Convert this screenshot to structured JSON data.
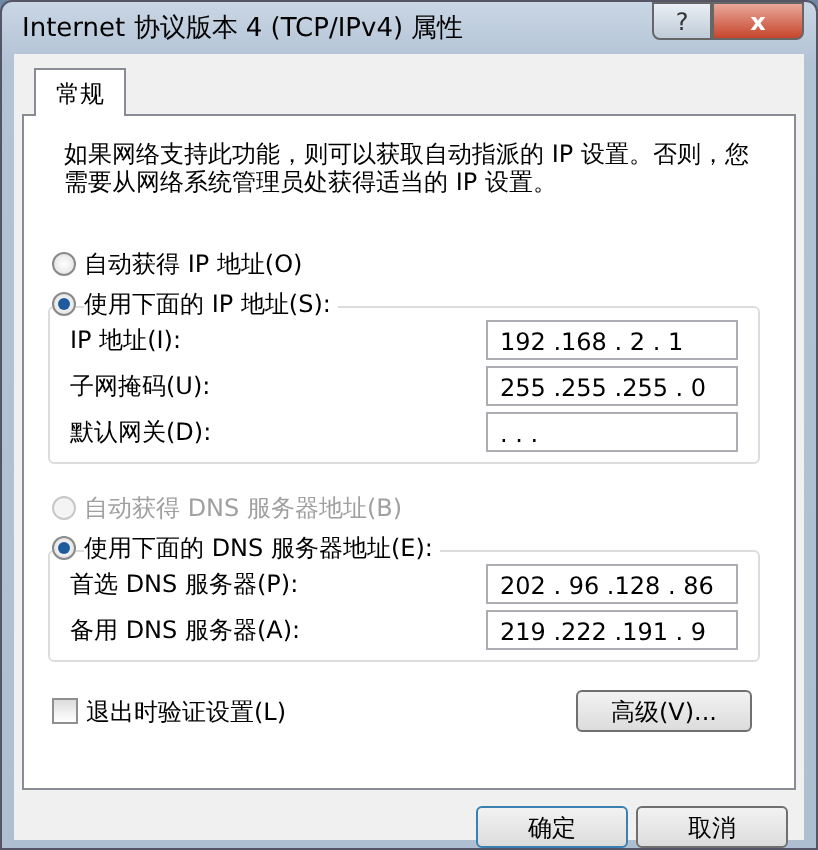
{
  "window": {
    "title": "Internet 协议版本 4 (TCP/IPv4) 属性",
    "buttons": [
      {
        "kind": "help",
        "label": "?"
      },
      {
        "kind": "close",
        "label": "x"
      }
    ]
  },
  "tabs": [
    {
      "label": "常规",
      "selected": true
    }
  ],
  "description": "如果网络支持此功能，则可以获取自动指派的 IP 设置。否则，您需要从网络系统管理员处获得适当的 IP 设置。",
  "ip_section": {
    "options": [
      {
        "label": "自动获得 IP 地址(O)",
        "selected": false,
        "disabled": false
      },
      {
        "label": "使用下面的 IP 地址(S):",
        "selected": true,
        "disabled": false
      }
    ],
    "fields": [
      {
        "label": "IP 地址(I):",
        "value": "192 .168 . 2 . 1"
      },
      {
        "label": "子网掩码(U):",
        "value": "255 .255 .255 . 0"
      },
      {
        "label": "默认网关(D):",
        "value": ". . ."
      }
    ]
  },
  "dns_section": {
    "options": [
      {
        "label": "自动获得 DNS 服务器地址(B)",
        "selected": false,
        "disabled": true
      },
      {
        "label": "使用下面的 DNS 服务器地址(E):",
        "selected": true,
        "disabled": false
      }
    ],
    "fields": [
      {
        "label": "首选 DNS 服务器(P):",
        "value": "202 . 96 .128 . 86"
      },
      {
        "label": "备用 DNS 服务器(A):",
        "value": "219 .222 .191 . 9"
      }
    ]
  },
  "validate_on_exit": {
    "label": "退出时验证设置(L)",
    "checked": false
  },
  "advanced_button": "高级(V)...",
  "footer_buttons": [
    "确定",
    "取消"
  ]
}
